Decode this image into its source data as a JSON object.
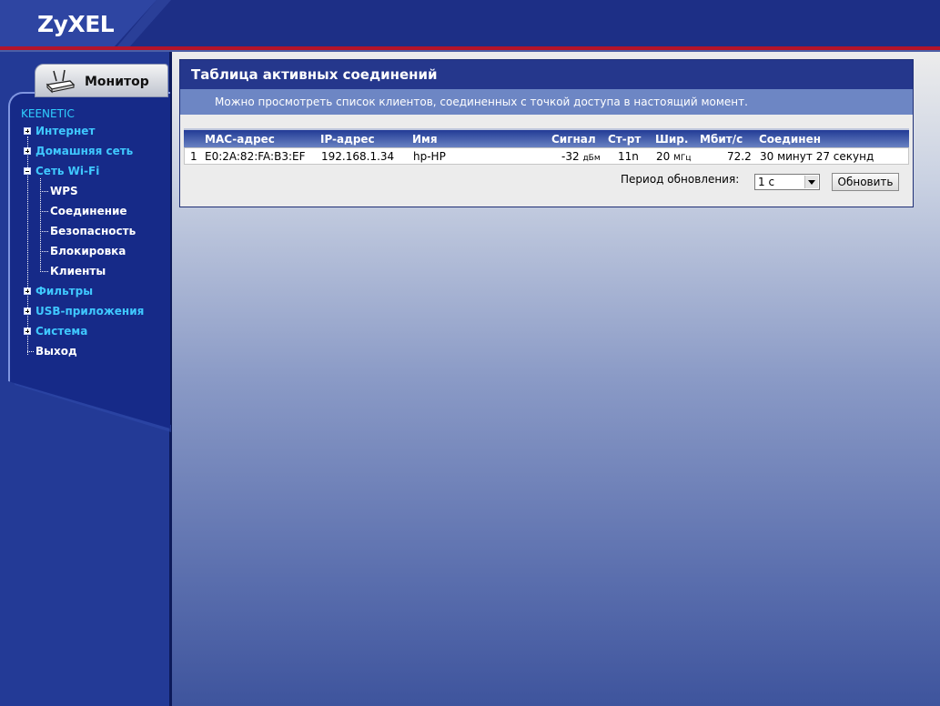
{
  "header": {
    "logo": "ZyXEL"
  },
  "tab": {
    "label": "Монитор",
    "icon": "router-icon"
  },
  "sidebar": {
    "brand": "KEENETIC",
    "items": [
      {
        "label": "Интернет",
        "expander": "plus"
      },
      {
        "label": "Домашняя сеть",
        "expander": "plus"
      },
      {
        "label": "Сеть Wi-Fi",
        "expander": "minus"
      },
      {
        "label": "WPS"
      },
      {
        "label": "Соединение"
      },
      {
        "label": "Безопасность"
      },
      {
        "label": "Блокировка"
      },
      {
        "label": "Клиенты"
      },
      {
        "label": "Фильтры",
        "expander": "plus"
      },
      {
        "label": "USB-приложения",
        "expander": "plus"
      },
      {
        "label": "Система",
        "expander": "plus"
      },
      {
        "label": "Выход"
      }
    ]
  },
  "panel": {
    "title": "Таблица активных соединений",
    "subtitle": "Можно просмотреть список клиентов, соединенных с точкой доступа в настоящий момент."
  },
  "table": {
    "headers": [
      "MAC-адрес",
      "IP-адрес",
      "Имя",
      "Сигнал",
      "Ст-рт",
      "Шир.",
      "Мбит/с",
      "Соединен"
    ],
    "rows": [
      {
        "num": "1",
        "mac": "E0:2A:82:FA:B3:EF",
        "ip": "192.168.1.34",
        "name": "hp-HP",
        "signal": "-32",
        "signal_unit": "дБм",
        "standard": "11n",
        "width": "20",
        "width_unit": "МГц",
        "rate": "72.2",
        "connected": "30 минут 27 секунд"
      }
    ]
  },
  "refresh": {
    "label": "Период обновления:",
    "selected": "1 с",
    "button": "Обновить"
  }
}
